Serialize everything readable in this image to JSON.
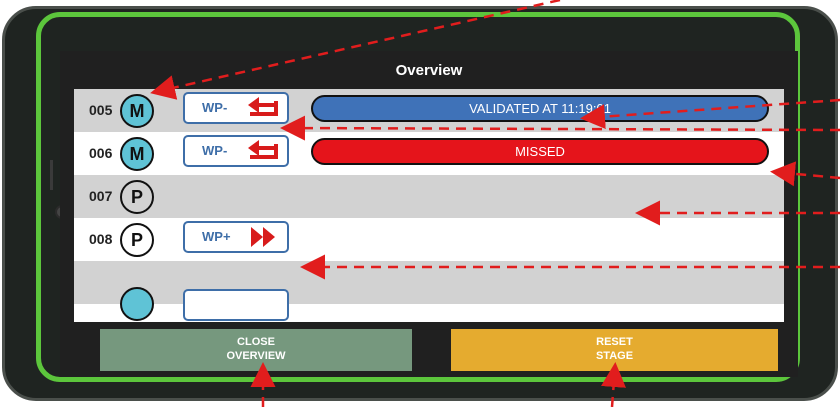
{
  "screen": {
    "title": "Overview",
    "rows": [
      {
        "number": "005",
        "badge": "M",
        "wp_label": "WP-",
        "wp_icon": "arrow-back-icon",
        "status": "VALIDATED AT 11:19:01",
        "status_color": "#3f72b8"
      },
      {
        "number": "006",
        "badge": "M",
        "wp_label": "WP-",
        "wp_icon": "arrow-back-icon",
        "status": "MISSED",
        "status_color": "#e5141b"
      },
      {
        "number": "007",
        "badge": "P"
      },
      {
        "number": "008",
        "badge": "P",
        "wp_label": "WP+",
        "wp_icon": "double-chevron-right-icon"
      }
    ],
    "buttons": {
      "close": {
        "line1": "CLOSE",
        "line2": "OVERVIEW"
      },
      "reset": {
        "line1": "RESET",
        "line2": "STAGE"
      }
    }
  },
  "colors": {
    "device_bezel": "#5cc63c",
    "close_button": "#76987e",
    "reset_button": "#e5ab2f",
    "annotation_arrows": "#e11d1d"
  }
}
